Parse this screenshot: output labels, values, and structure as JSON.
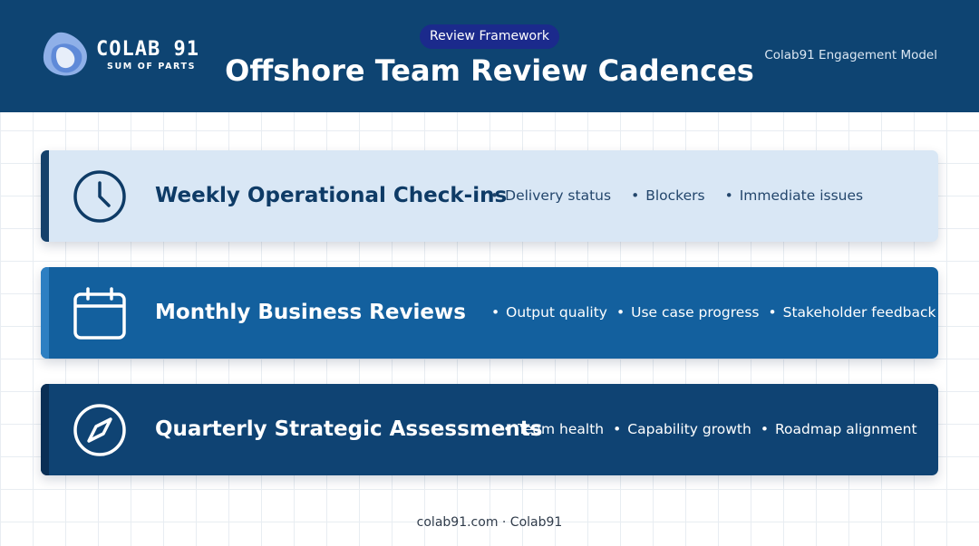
{
  "header": {
    "logo": {
      "title": "COLAB 91",
      "subtitle": "SUM OF PARTS",
      "icon": "colab-logo-icon"
    },
    "badge": "Review Framework",
    "title": "Offshore Team Review Cadences",
    "engagement": "Colab91 Engagement Model",
    "background_color": "#0e4472"
  },
  "cadences": [
    {
      "icon": "clock-icon",
      "title": "Weekly Operational Check-ins",
      "bullets": [
        "Delivery status",
        "Blockers",
        "Immediate issues"
      ],
      "background_color": "#d9e7f5"
    },
    {
      "icon": "calendar-icon",
      "title": "Monthly Business Reviews",
      "bullets": [
        "Output quality",
        "Use case progress",
        "Stakeholder feedback"
      ],
      "background_color": "#13609e"
    },
    {
      "icon": "compass-icon",
      "title": "Quarterly Strategic Assessments",
      "bullets": [
        "Team health",
        "Capability growth",
        "Roadmap alignment"
      ],
      "background_color": "#0f4373"
    }
  ],
  "footer": "colab91.com · Colab91"
}
